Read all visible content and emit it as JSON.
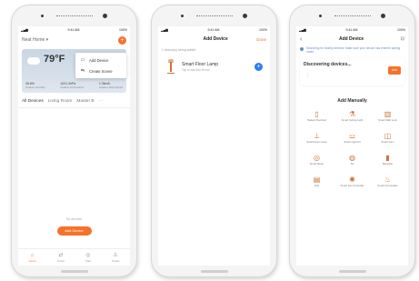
{
  "screen1": {
    "status_time": "9:41 AM",
    "status_battery": "100%",
    "home_title": "Neat Home ▾",
    "weather": {
      "temperature": "79°F",
      "stats": [
        {
          "value": "35.6%",
          "label": "Outdoor Humidity"
        },
        {
          "value": "1021.3hPa",
          "label": "Outdoor Air Pressure"
        },
        {
          "value": "1.3km/h",
          "label": "Outdoor Wind Speed"
        }
      ]
    },
    "menu": [
      {
        "label": "Add Device",
        "icon": "▭"
      },
      {
        "label": "Create Scene",
        "icon": "⇆"
      }
    ],
    "rooms": [
      "All Devices",
      "Living Room",
      "Master B"
    ],
    "more": "···",
    "empty_text": "No devices",
    "add_button": "Add Device",
    "tabs": [
      {
        "label": "Home",
        "icon": "⌂"
      },
      {
        "label": "Smart",
        "icon": "⇄"
      },
      {
        "label": "Mall",
        "icon": "◎"
      },
      {
        "label": "Profile",
        "icon": "♙"
      }
    ]
  },
  "screen2": {
    "status_time": "9:41 AM",
    "status_battery": "100%",
    "title": "Add Device",
    "done": "Done",
    "note": "1 device(s) being added",
    "device_name": "Smart Floor Lamp",
    "device_sub": "Tap to add this device"
  },
  "screen3": {
    "status_time": "9:41 AM",
    "status_battery": "100%",
    "back": "‹",
    "title": "Add Device",
    "scan": "⊡",
    "info": "Searching for nearby devices. Make sure your device has entered pairing mode.",
    "discover_title": "Discovering devices...",
    "discover_spinner": "⋮",
    "discover_button": "Add",
    "manual_title": "Add Manually",
    "manual": [
      {
        "label": "Battery Doorbell",
        "icon": "▯"
      },
      {
        "label": "Smart Ceiling Light",
        "icon": "⚗"
      },
      {
        "label": "Smart Wall Lock",
        "icon": "▥"
      },
      {
        "label": "Smart Floor Lamp",
        "icon": "⊥"
      },
      {
        "label": "Smart Light Kit",
        "icon": "⚍"
      },
      {
        "label": "Smart Cam",
        "icon": "◫"
      },
      {
        "label": "Smart Meter",
        "icon": "◎"
      },
      {
        "label": "Kit",
        "icon": "◍"
      },
      {
        "label": "Repeater",
        "icon": "▮"
      },
      {
        "label": "Hub",
        "icon": "▤"
      },
      {
        "label": "Smart Fan Controller",
        "icon": "✺"
      },
      {
        "label": "Smart Fan Heater",
        "icon": "♨"
      }
    ]
  }
}
